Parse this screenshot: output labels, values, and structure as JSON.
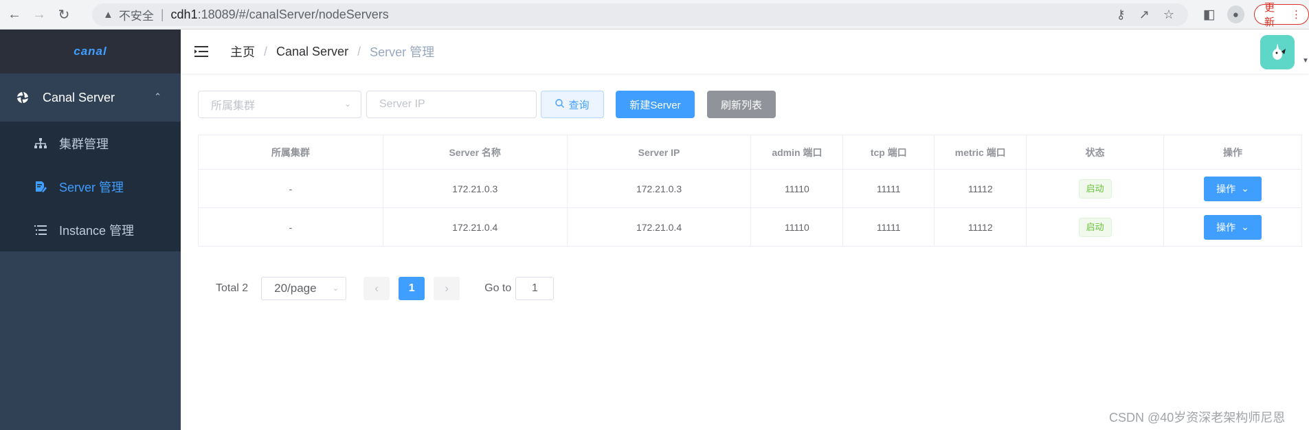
{
  "browser": {
    "warning_text": "不安全",
    "url_host": "cdh1",
    "url_path": ":18089/#/canalServer/nodeServers",
    "update_label": "更新"
  },
  "sidebar": {
    "logo": "canal",
    "menu_title": "Canal Server",
    "items": [
      {
        "label": "集群管理",
        "icon": "sitemap-icon"
      },
      {
        "label": "Server 管理",
        "icon": "edit-doc-icon"
      },
      {
        "label": "Instance 管理",
        "icon": "list-icon"
      }
    ]
  },
  "header": {
    "breadcrumb": [
      "主页",
      "Canal Server",
      "Server 管理"
    ]
  },
  "filter": {
    "cluster_placeholder": "所属集群",
    "ip_placeholder": "Server IP",
    "query_label": "查询",
    "new_label": "新建Server",
    "refresh_label": "刷新列表"
  },
  "table": {
    "columns": [
      "所属集群",
      "Server 名称",
      "Server IP",
      "admin 端口",
      "tcp 端口",
      "metric 端口",
      "状态",
      "操作"
    ],
    "rows": [
      {
        "cluster": "-",
        "name": "172.21.0.3",
        "ip": "172.21.0.3",
        "admin": "11110",
        "tcp": "11111",
        "metric": "11112",
        "status": "启动",
        "action": "操作"
      },
      {
        "cluster": "-",
        "name": "172.21.0.4",
        "ip": "172.21.0.4",
        "admin": "11110",
        "tcp": "11111",
        "metric": "11112",
        "status": "启动",
        "action": "操作"
      }
    ]
  },
  "pagination": {
    "total": "Total 2",
    "page_size": "20/page",
    "current": "1",
    "goto_label": "Go to",
    "goto_value": "1"
  },
  "watermark": "CSDN @40岁资深老架构师尼恩",
  "colors": {
    "sidebar_bg": "#304156",
    "submenu_bg": "#1f2d3d",
    "primary": "#409eff",
    "success": "#67c23a"
  }
}
